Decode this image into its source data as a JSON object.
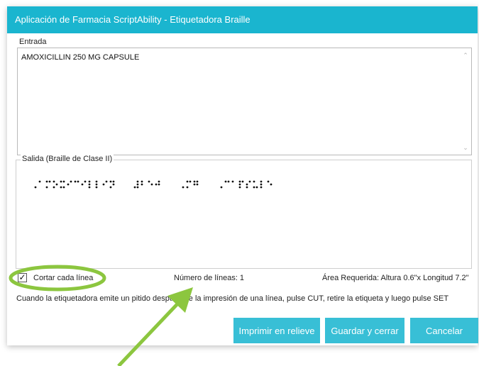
{
  "window": {
    "title": "Aplicación de Farmacia ScriptAbility - Etiquetadora Braille"
  },
  "input": {
    "label": "Entrada",
    "value": "AMOXICILLIN 250 MG CAPSULE"
  },
  "output": {
    "label": "Salida (Braille de Clase II)",
    "braille_words": [
      "⠠⠁⠍⠕⠭⠊⠉⠊⠇⠇⠊⠝",
      "⠼⠃⠑⠚",
      "⠠⠍⠛",
      "⠠⠉⠁⠏⠎⠥⠇⠑"
    ]
  },
  "footer": {
    "checkbox_label": "Cortar cada línea",
    "checkbox_checked": true,
    "line_count": "Número de líneas: 1",
    "area": "Área Requerida: Altura 0.6\"x Longitud 7.2\"",
    "instruction": "Cuando la etiquetadora emite un pitido después de la impresión de una línea, pulse CUT, retire la etiqueta y luego pulse SET"
  },
  "buttons": {
    "emboss": "Imprimir en relieve",
    "save_close": "Guardar y cerrar",
    "cancel": "Cancelar"
  },
  "colors": {
    "accent": "#1ab5cf",
    "button": "#38bfd6",
    "annotation": "#8cc63f"
  }
}
